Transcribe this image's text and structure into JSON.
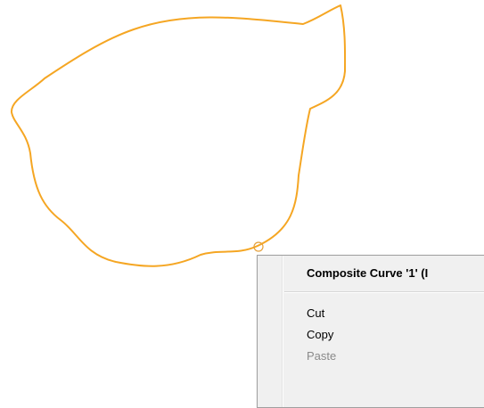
{
  "canvas": {
    "curve_color": "#F5A623",
    "handle_color": "#E5A03A"
  },
  "context_menu": {
    "header": "Composite Curve '1' (I",
    "items": [
      {
        "label": "Cut",
        "enabled": true
      },
      {
        "label": "Copy",
        "enabled": true
      },
      {
        "label": "Paste",
        "enabled": false
      }
    ]
  }
}
